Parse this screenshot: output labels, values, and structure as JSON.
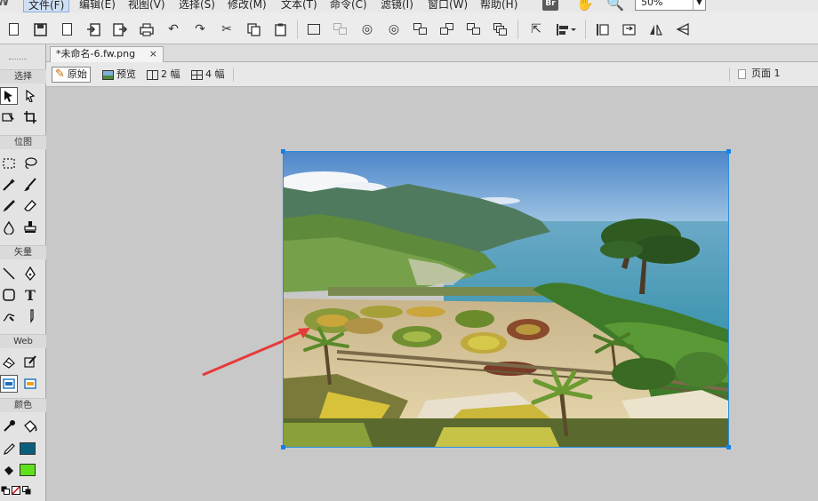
{
  "menubar": {
    "app_logo": "W",
    "items": [
      "文件(F)",
      "编辑(E)",
      "视图(V)",
      "选择(S)",
      "修改(M)",
      "文本(T)",
      "命令(C)",
      "滤镜(I)",
      "窗口(W)",
      "帮助(H)"
    ],
    "bridge_label": "Br",
    "zoom_value": "50%"
  },
  "document": {
    "tab_title": "*未命名-6.fw.png",
    "tab_close": "×"
  },
  "viewbar": {
    "original": "原始",
    "preview": "预览",
    "two_up": "2 幅",
    "four_up": "4 幅",
    "page": "页面 1"
  },
  "tools": {
    "sections": {
      "select": "选择",
      "bitmap": "位图",
      "vector": "矢量",
      "web": "Web",
      "colors": "颜色"
    },
    "text_tool_glyph": "T"
  },
  "colors": {
    "stroke": "#0b5f7c",
    "fill": "#5fe01a",
    "selection": "#2a8ee0",
    "arrow": "#e63a3a"
  }
}
